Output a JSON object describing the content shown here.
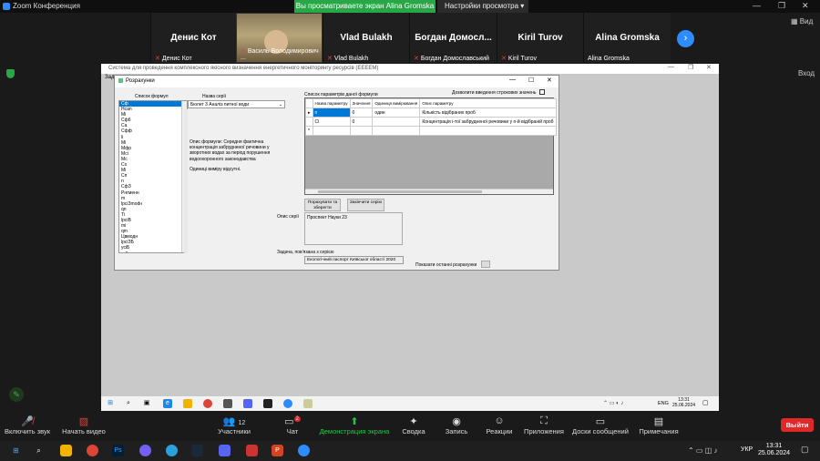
{
  "zoom": {
    "title": "Zoom Конференция",
    "share_banner": "Вы просматриваете экран Alina Gromska",
    "view_options": "Настройки просмотра ▾",
    "layout_label": "Вид",
    "enter_label": "Вход"
  },
  "participants": [
    {
      "name": "Денис Кот",
      "label": "Денис Кот",
      "muted": true
    },
    {
      "name": "",
      "label": "Василь Володимирович ...",
      "muted": true,
      "video": true
    },
    {
      "name": "Vlad Bulakh",
      "label": "Vlad Bulakh",
      "muted": true
    },
    {
      "name": "Богдан Домосл...",
      "label": "Богдан Домославський",
      "muted": true
    },
    {
      "name": "Kiril Turov",
      "label": "Kiril Turov",
      "muted": true
    },
    {
      "name": "Alina Gromska",
      "label": "Alina Gromska",
      "muted": false
    }
  ],
  "app": {
    "title": "Система для проведення комплексного якісного визначення енергетичного моніторингу ресурсів (ЕЕЕЕМ)",
    "menu": "Зад"
  },
  "dialog": {
    "title": "Розрахунки",
    "formula_list_label": "Список формул",
    "series_name_label": "Назва серії",
    "series_value": "Бюлет 3 Аналіз питної води",
    "formula_desc": "Опис формули: Середня фактична концентрація забрудненої речовини у зворотних водах за період порушення водоохоронного законодавства",
    "unit": "Одиниці виміру відсутні.",
    "params_label": "Список параметрів даної формули",
    "allow_text": "Дозволити введення строкових значень",
    "columns": [
      "Назва параметру",
      "Значення",
      "Одиниця вимірювання",
      "Опис параметру"
    ],
    "rows": [
      {
        "name": "n",
        "value": "0",
        "unit": "один",
        "desc": "Кількість відібраних проб"
      },
      {
        "name": "Ci",
        "value": "0",
        "unit": "",
        "desc": "Концентрація і-тої  забрудненої речовини у n-й відібраній проб"
      }
    ],
    "btn_calc_save": "Порахувати та зберегти",
    "btn_finish": "Закінчити серію",
    "series_desc_label": "Опис серії",
    "series_desc": "Проспект Науки 23",
    "task_label": "Задача, пов'язана з серією",
    "task_value": "Екологічний паспорт Київської області 2020",
    "show_last": "Показати останні розрахунки",
    "formulas": [
      "Сф",
      "Нсаn",
      "Мi",
      "Сфб",
      "Са",
      "Сфф",
      "li",
      "Мi",
      "Мфр",
      "Мсi",
      "Мс",
      "Сs",
      "Мi",
      "Сп",
      "n",
      "СфЗ",
      "Рнгменн",
      "m",
      "lрсiЗmodн",
      "qn",
      "Ti",
      "lрсiВ",
      "mi",
      "qm",
      "Цвмодн",
      "lрсiЗБ",
      "усiБ",
      "mФрнг n",
      "mФвнгр"
    ]
  },
  "remote_taskbar": {
    "lang": "ENG",
    "time": "13:31",
    "date": "25.06.2024"
  },
  "toolbar": {
    "mute": "Включить звук",
    "video": "Начать видео",
    "participants": "Участники",
    "participants_count": "12",
    "chat": "Чат",
    "chat_badge": "2",
    "share": "Демонстрация экрана",
    "summary": "Сводка",
    "record": "Запись",
    "reactions": "Реакции",
    "apps": "Приложения",
    "board": "Доски сообщений",
    "notes": "Примечания",
    "leave": "Выйти"
  },
  "win_taskbar": {
    "lang": "УКР",
    "time": "13:31",
    "date": "25.06.2024"
  }
}
